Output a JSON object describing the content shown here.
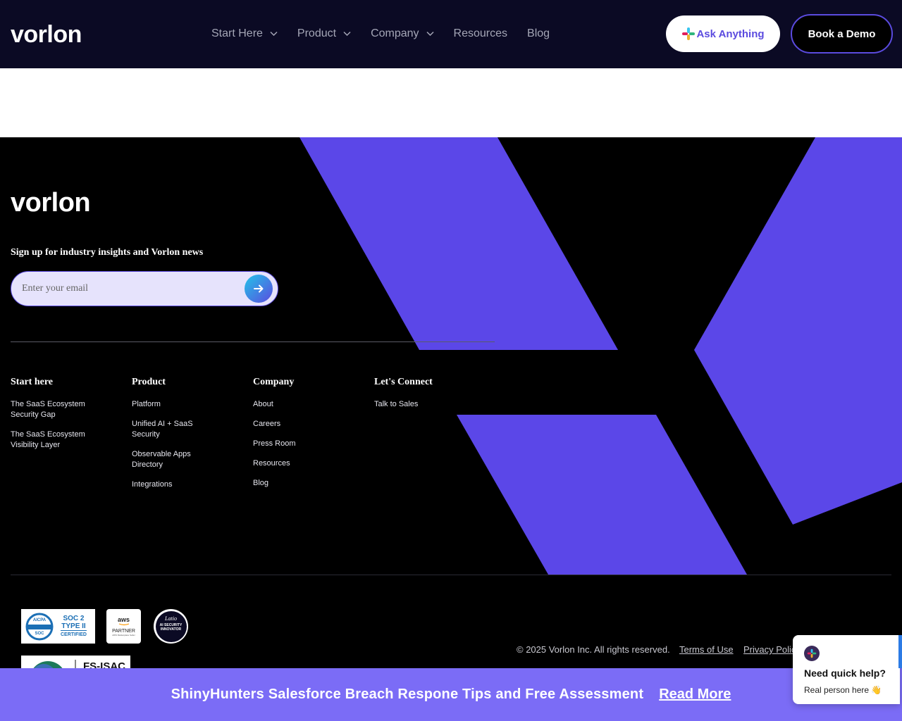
{
  "header": {
    "logo": "vorlon",
    "nav": [
      {
        "label": "Start Here",
        "dropdown": true
      },
      {
        "label": "Product",
        "dropdown": true
      },
      {
        "label": "Company",
        "dropdown": true
      },
      {
        "label": "Resources",
        "dropdown": false
      },
      {
        "label": "Blog",
        "dropdown": false
      }
    ],
    "ask_button": "Ask Anything",
    "demo_button": "Book a Demo"
  },
  "footer": {
    "logo": "vorlon",
    "signup_heading": "Sign up for industry insights and Vorlon news",
    "email_placeholder": "Enter your email",
    "columns": [
      {
        "heading": "Start here",
        "links": [
          "The SaaS Ecosystem Security Gap",
          "The SaaS Ecosystem Visibility Layer"
        ]
      },
      {
        "heading": "Product",
        "links": [
          "Platform",
          "Unified AI + SaaS Security",
          "Observable Apps Directory",
          "Integrations"
        ]
      },
      {
        "heading": "Company",
        "links": [
          "About",
          "Careers",
          "Press Room",
          "Resources",
          "Blog"
        ]
      },
      {
        "heading": "Let's Connect",
        "links": [
          "Talk to Sales"
        ]
      }
    ],
    "badges": {
      "soc": {
        "org": "AICPA",
        "label": "SOC",
        "line1": "SOC 2",
        "line2": "TYPE II",
        "line3": "CERTIFIED"
      },
      "aws": {
        "brand": "aws",
        "line1": "PARTNER",
        "line2": "AWS Marketplace Seller"
      },
      "latio": {
        "brand": "Latio",
        "line1": "AI SECURITY",
        "line2": "INNOVATOR"
      },
      "fsisac": {
        "label": "FS-ISAC"
      }
    },
    "copyright": "© 2025 Vorlon Inc. All rights reserved.",
    "terms": "Terms of Use",
    "privacy": "Privacy Polic"
  },
  "banner": {
    "text": "ShinyHunters Salesforce Breach Respone Tips and Free Assessment",
    "link": "Read More"
  },
  "chat": {
    "title": "Need quick help?",
    "subtitle": "Real person here 👋"
  },
  "colors": {
    "header_bg": "#0b0a24",
    "accent": "#5b4bdf",
    "deco": "#5b47e8",
    "banner_bg": "#7b6cf6"
  },
  "icons": [
    "chevron-down-icon",
    "slack-icon",
    "arrow-right-icon",
    "slack-icon"
  ]
}
